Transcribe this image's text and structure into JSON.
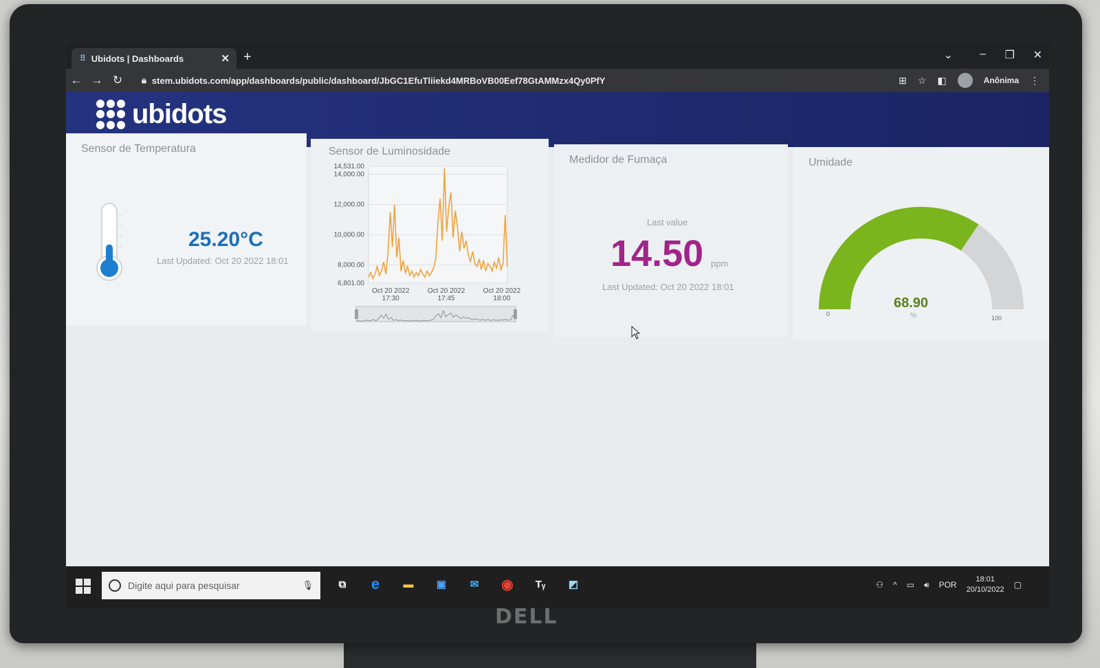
{
  "browser": {
    "tab_title": "Ubidots | Dashboards",
    "new_tab": "+",
    "close_tab": "✕",
    "url": "stem.ubidots.com/app/dashboards/public/dashboard/JbGC1EfuTliiekd4MRBoVB00Eef78GtAMMzx4Qy0PfY",
    "profile_label": "Anônima",
    "controls": {
      "dropdown": "⌄",
      "minimize": "–",
      "restore": "❐",
      "close": "✕"
    }
  },
  "app": {
    "brand": "ubidots"
  },
  "widgets": {
    "temperature": {
      "title": "Sensor de Temperatura",
      "value": "25.20°C",
      "updated": "Last Updated: Oct 20 2022 18:01",
      "level": 0.4
    },
    "light": {
      "title": "Sensor de Luminosidade"
    },
    "smoke": {
      "title": "Medidor de Fumaça",
      "label": "Last value",
      "value": "14.50",
      "unit": "ppm",
      "updated": "Last Updated: Oct 20 2022 18:01"
    },
    "humidity": {
      "title": "Umidade",
      "value": "68.90",
      "unit": "%",
      "min": "0",
      "max": "100",
      "fraction": 0.689,
      "fill_color": "#7ab51d",
      "track_color": "#d3d5d6"
    }
  },
  "chart_data": {
    "type": "line",
    "title": "Sensor de Luminosidade",
    "xlabel": "",
    "ylabel": "",
    "ylim": [
      6801,
      14531
    ],
    "yticks": [
      "14,531.00",
      "14,000.00",
      "12,000.00",
      "10,000.00",
      "8,000.00",
      "6,801.00"
    ],
    "ytick_values": [
      14531,
      14000,
      12000,
      10000,
      8000,
      6801
    ],
    "xticks": [
      {
        "date": "Oct 20 2022",
        "time": "17:30"
      },
      {
        "date": "Oct 20 2022",
        "time": "17:45"
      },
      {
        "date": "Oct 20 2022",
        "time": "18:00"
      }
    ],
    "color": "#f0a23c",
    "series": [
      {
        "values": [
          7200,
          7500,
          7100,
          7400,
          7900,
          7300,
          7600,
          8200,
          7400,
          8800,
          11500,
          9200,
          12000,
          8500,
          9800,
          7600,
          8300,
          7500,
          7900,
          7300,
          7600,
          7200,
          7500,
          7300,
          7700,
          7400,
          7200,
          7600,
          7300,
          7500,
          7800,
          8400,
          10800,
          12400,
          9600,
          14400,
          10200,
          11900,
          12800,
          9800,
          11600,
          10500,
          8900,
          10200,
          9100,
          9600,
          8700,
          8200,
          8900,
          8100,
          7900,
          8400,
          7700,
          8300,
          7600,
          8100,
          7900,
          7600,
          8200,
          7800,
          8500,
          7700,
          8100,
          11300,
          7900
        ]
      }
    ]
  },
  "taskbar": {
    "search_placeholder": "Digite aqui para pesquisar",
    "language": "POR",
    "time": "18:01",
    "date": "20/10/2022"
  },
  "monitor": {
    "brand": "DELL"
  }
}
